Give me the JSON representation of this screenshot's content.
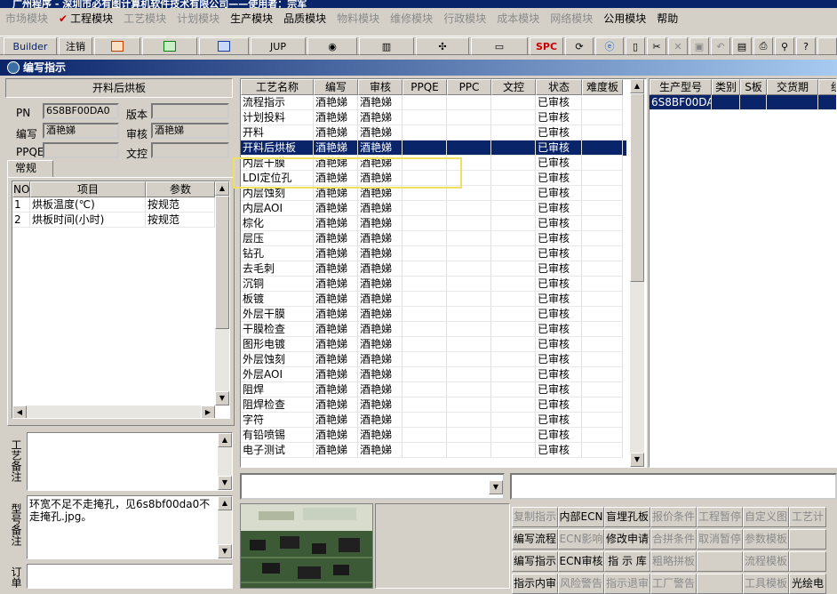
{
  "window": {
    "title": "广州程序 - 深圳市必有图计算机软件技术有限公司——使用者：宗军"
  },
  "menu": [
    {
      "label": "市场模块",
      "enabled": false
    },
    {
      "label": "工程模块",
      "enabled": true,
      "checked": true
    },
    {
      "label": "工艺模块",
      "enabled": false
    },
    {
      "label": "计划模块",
      "enabled": false
    },
    {
      "label": "生产模块",
      "enabled": true
    },
    {
      "label": "品质模块",
      "enabled": true
    },
    {
      "label": "物料模块",
      "enabled": false
    },
    {
      "label": "维修模块",
      "enabled": false
    },
    {
      "label": "行政模块",
      "enabled": false
    },
    {
      "label": "成本模块",
      "enabled": false
    },
    {
      "label": "网络模块",
      "enabled": false
    },
    {
      "label": "公用模块",
      "enabled": true
    },
    {
      "label": "帮助",
      "enabled": true
    }
  ],
  "toolbar": {
    "builder": "Builder",
    "logout": "注销",
    "jup": "JUP",
    "spc": "SPC"
  },
  "dialog": {
    "title": "编写指示"
  },
  "left": {
    "process_name": "开料后烘板",
    "pn_label": "PN",
    "pn_value": "6S8BF00DA0",
    "version_label": "版本",
    "version_value": "",
    "author_label": "编写",
    "author_value": "酒艳娣",
    "review_label": "审核",
    "review_value": "酒艳娣",
    "ppqe_label": "PPQE",
    "ppqe_value": "",
    "doc_label": "文控",
    "doc_value": "",
    "tab": "常规",
    "param_headers": [
      "NO",
      "项目",
      "参数"
    ],
    "params": [
      {
        "no": "1",
        "item": "烘板温度(℃)",
        "value": "按规范"
      },
      {
        "no": "2",
        "item": "烘板时间(小时)",
        "value": "按规范"
      }
    ],
    "process_note_label": "工艺备注",
    "model_note_label": "型号备注",
    "model_note": "环宽不足不走掩孔，见6s8bf00da0不走掩孔.jpg。",
    "order_note_label": "订单"
  },
  "grid": {
    "headers": [
      "工艺名称",
      "编写",
      "审核",
      "PPQE",
      "PPC",
      "文控",
      "状态",
      "难度板"
    ],
    "rows": [
      [
        "流程指示",
        "酒艳娣",
        "酒艳娣",
        "",
        "",
        "",
        "已审核",
        ""
      ],
      [
        "计划投料",
        "酒艳娣",
        "酒艳娣",
        "",
        "",
        "",
        "已审核",
        ""
      ],
      [
        "开料",
        "酒艳娣",
        "酒艳娣",
        "",
        "",
        "",
        "已审核",
        ""
      ],
      [
        "开料后烘板",
        "酒艳娣",
        "酒艳娣",
        "",
        "",
        "",
        "已审核",
        ""
      ],
      [
        "内层干膜",
        "酒艳娣",
        "酒艳娣",
        "",
        "",
        "",
        "已审核",
        ""
      ],
      [
        "LDI定位孔",
        "酒艳娣",
        "酒艳娣",
        "",
        "",
        "",
        "已审核",
        ""
      ],
      [
        "内层蚀刻",
        "酒艳娣",
        "酒艳娣",
        "",
        "",
        "",
        "已审核",
        ""
      ],
      [
        "内层AOI",
        "酒艳娣",
        "酒艳娣",
        "",
        "",
        "",
        "已审核",
        ""
      ],
      [
        "棕化",
        "酒艳娣",
        "酒艳娣",
        "",
        "",
        "",
        "已审核",
        ""
      ],
      [
        "层压",
        "酒艳娣",
        "酒艳娣",
        "",
        "",
        "",
        "已审核",
        ""
      ],
      [
        "钻孔",
        "酒艳娣",
        "酒艳娣",
        "",
        "",
        "",
        "已审核",
        ""
      ],
      [
        "去毛刺",
        "酒艳娣",
        "酒艳娣",
        "",
        "",
        "",
        "已审核",
        ""
      ],
      [
        "沉铜",
        "酒艳娣",
        "酒艳娣",
        "",
        "",
        "",
        "已审核",
        ""
      ],
      [
        "板镀",
        "酒艳娣",
        "酒艳娣",
        "",
        "",
        "",
        "已审核",
        ""
      ],
      [
        "外层干膜",
        "酒艳娣",
        "酒艳娣",
        "",
        "",
        "",
        "已审核",
        ""
      ],
      [
        "干膜检查",
        "酒艳娣",
        "酒艳娣",
        "",
        "",
        "",
        "已审核",
        ""
      ],
      [
        "图形电镀",
        "酒艳娣",
        "酒艳娣",
        "",
        "",
        "",
        "已审核",
        ""
      ],
      [
        "外层蚀刻",
        "酒艳娣",
        "酒艳娣",
        "",
        "",
        "",
        "已审核",
        ""
      ],
      [
        "外层AOI",
        "酒艳娣",
        "酒艳娣",
        "",
        "",
        "",
        "已审核",
        ""
      ],
      [
        "阻焊",
        "酒艳娣",
        "酒艳娣",
        "",
        "",
        "",
        "已审核",
        ""
      ],
      [
        "阻焊检查",
        "酒艳娣",
        "酒艳娣",
        "",
        "",
        "",
        "已审核",
        ""
      ],
      [
        "字符",
        "酒艳娣",
        "酒艳娣",
        "",
        "",
        "",
        "已审核",
        ""
      ],
      [
        "有铅喷锡",
        "酒艳娣",
        "酒艳娣",
        "",
        "",
        "",
        "已审核",
        ""
      ],
      [
        "电子测试",
        "酒艳娣",
        "酒艳娣",
        "",
        "",
        "",
        "已审核",
        ""
      ]
    ],
    "selected_index": 3
  },
  "right_grid": {
    "headers": [
      "生产型号",
      "类别",
      "S板",
      "交货期",
      "组"
    ],
    "rows": [
      [
        "6S8BF00DA0",
        "",
        "",
        "",
        ""
      ]
    ]
  },
  "buttons": [
    [
      {
        "label": "复制指示",
        "enabled": false
      },
      {
        "label": "内部ECN",
        "enabled": true
      },
      {
        "label": "盲埋孔板",
        "enabled": true
      },
      {
        "label": "报价条件",
        "enabled": false
      },
      {
        "label": "工程暂停",
        "enabled": false
      },
      {
        "label": "自定义图",
        "enabled": false
      },
      {
        "label": "工艺计",
        "enabled": false
      }
    ],
    [
      {
        "label": "编写流程",
        "enabled": true
      },
      {
        "label": "ECN影响",
        "enabled": false
      },
      {
        "label": "修改申请",
        "enabled": true
      },
      {
        "label": "合拼条件",
        "enabled": false
      },
      {
        "label": "取消暂停",
        "enabled": false
      },
      {
        "label": "参数模板",
        "enabled": false
      },
      {
        "label": "",
        "enabled": false
      }
    ],
    [
      {
        "label": "编写指示",
        "enabled": true
      },
      {
        "label": "ECN审核",
        "enabled": true
      },
      {
        "label": "指 示 库",
        "enabled": true
      },
      {
        "label": "粗略拼板",
        "enabled": false
      },
      {
        "label": "",
        "enabled": false
      },
      {
        "label": "流程模板",
        "enabled": false
      },
      {
        "label": "",
        "enabled": false
      }
    ],
    [
      {
        "label": "指示内审",
        "enabled": true
      },
      {
        "label": "风险警告",
        "enabled": false
      },
      {
        "label": "指示退审",
        "enabled": false
      },
      {
        "label": "工厂警告",
        "enabled": false
      },
      {
        "label": "",
        "enabled": false
      },
      {
        "label": "工具模板",
        "enabled": false
      },
      {
        "label": "光绘电",
        "enabled": true
      }
    ]
  ]
}
